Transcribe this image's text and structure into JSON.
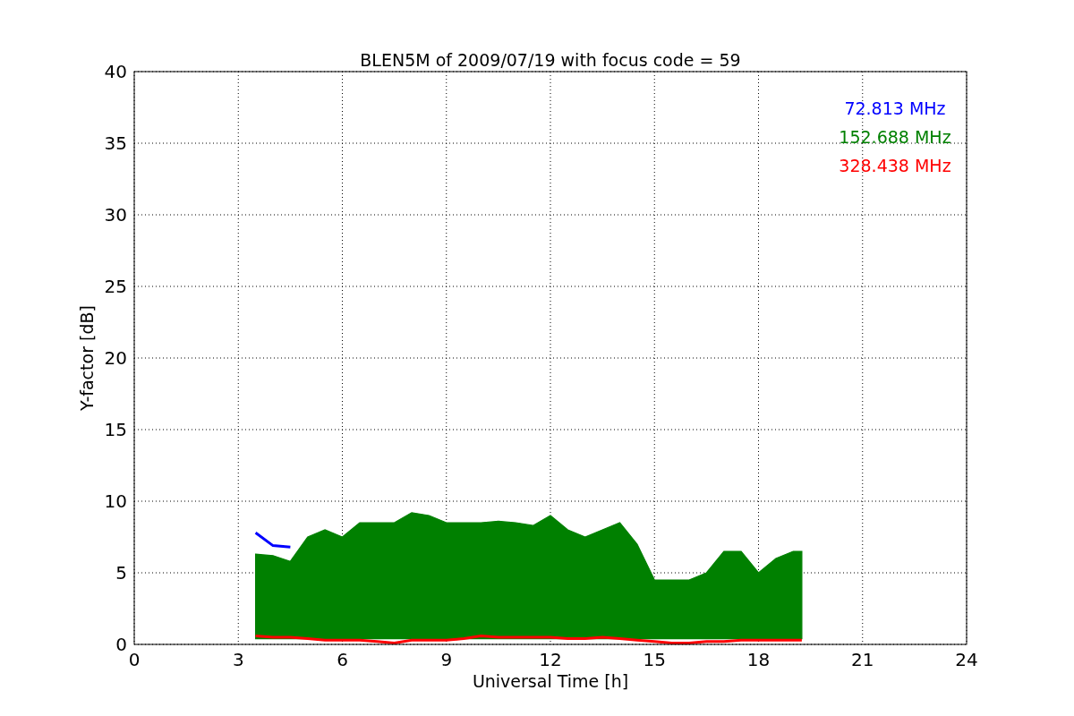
{
  "chart_data": {
    "type": "line",
    "title": "BLEN5M of 2009/07/19 with focus code = 59",
    "xlabel": "Universal Time [h]",
    "ylabel": "Y-factor [dB]",
    "x": [
      3.5,
      4,
      4.5,
      5,
      5.5,
      6,
      6.5,
      7,
      7.5,
      8,
      8.5,
      9,
      9.5,
      10,
      10.5,
      11,
      11.5,
      12,
      12.5,
      13,
      13.5,
      14,
      14.5,
      15,
      15.5,
      16,
      16.5,
      17,
      17.5,
      18,
      18.5,
      19,
      19.25
    ],
    "series": [
      {
        "name": "72.813 MHz",
        "color": "#0000ff",
        "values": [
          7.8,
          6.9,
          6.8,
          null,
          null,
          null,
          null,
          null,
          null,
          null,
          null,
          null,
          null,
          null,
          null,
          null,
          null,
          null,
          null,
          null,
          null,
          null,
          null,
          null,
          null,
          null,
          null,
          null,
          null,
          null,
          null,
          null,
          null
        ]
      },
      {
        "name": "152.688 MHz",
        "type": "area",
        "color": "#008000",
        "values": [
          6.3,
          6.2,
          5.8,
          7.5,
          8,
          7.5,
          8.5,
          8.5,
          8.5,
          9.2,
          9,
          8.5,
          8.5,
          8.5,
          8.6,
          8.5,
          8.3,
          9,
          8,
          7.5,
          8,
          8.5,
          7,
          4.5,
          4.5,
          4.5,
          5,
          6.5,
          6.5,
          5,
          6,
          6.5,
          6.5
        ]
      },
      {
        "name": "328.438 MHz",
        "color": "#ff0000",
        "values": [
          0.6,
          0.5,
          0.5,
          0.4,
          0.3,
          0.3,
          0.3,
          0.2,
          0.1,
          0.3,
          0.3,
          0.3,
          0.4,
          0.6,
          0.5,
          0.5,
          0.5,
          0.5,
          0.4,
          0.4,
          0.5,
          0.4,
          0.3,
          0.2,
          0.1,
          0.1,
          0.2,
          0.2,
          0.3,
          0.3,
          0.3,
          0.3,
          0.3
        ]
      }
    ],
    "grid": true,
    "xlim": [
      0,
      24
    ],
    "ylim": [
      0,
      40
    ],
    "xticks": [
      0,
      3,
      6,
      9,
      12,
      15,
      18,
      21,
      24
    ],
    "yticks": [
      0,
      5,
      10,
      15,
      20,
      25,
      30,
      35,
      40
    ]
  }
}
